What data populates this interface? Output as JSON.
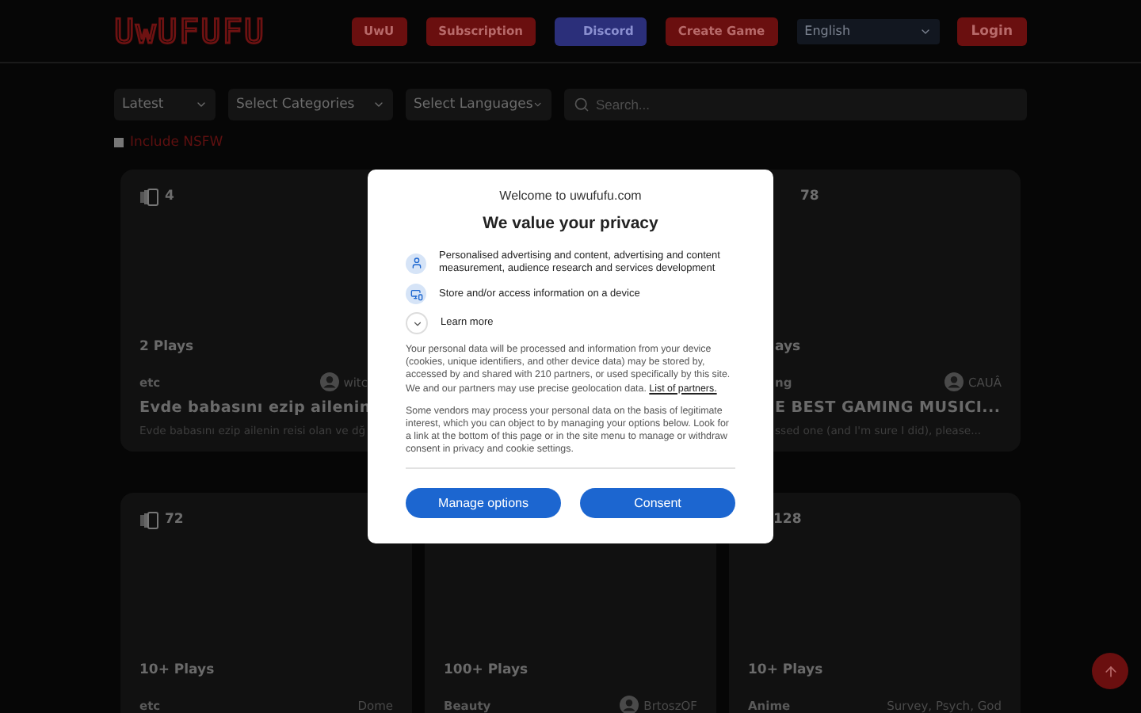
{
  "header": {
    "logo": "UwUFUFU",
    "buttons": [
      {
        "label": "UwU",
        "kind": "red"
      },
      {
        "label": "Subscription",
        "kind": "red"
      },
      {
        "label": "Discord",
        "kind": "blue"
      },
      {
        "label": "Create Game",
        "kind": "red"
      }
    ],
    "language": "English",
    "login": "Login"
  },
  "filters": {
    "sort": "Latest",
    "categories": "Select Categories",
    "languages": "Select Languages",
    "search_placeholder": "Search...",
    "nsfw": {
      "label": "Include NSFW",
      "checked": false
    }
  },
  "cards": [
    {
      "kind": "covered_right",
      "count": "4",
      "count_icon": true,
      "plays": "2 Plays",
      "category": "etc",
      "author": "witc",
      "title": "Evde babasını ezip ailenin",
      "description": "Evde babasını ezip ailenin reisi olan ve dğ"
    },
    {
      "kind": "hidden"
    },
    {
      "kind": "covered_left",
      "count": "78",
      "count_icon": false,
      "plays": "ays",
      "category": "ng",
      "author": "CAUÂ",
      "title": "E BEST GAMING MUSICI...",
      "description": "ssed one (and I'm sure I did), please..."
    },
    {
      "kind": "full",
      "count": "72",
      "count_icon": true,
      "plays": "10+ Plays",
      "category": "etc",
      "author": "Dome",
      "author_icon": false
    },
    {
      "kind": "full",
      "plays": "100+ Plays",
      "category": "Beauty",
      "author": "BrtoszOF",
      "author_icon": true
    },
    {
      "kind": "full",
      "count": "128",
      "count_icon": false,
      "plays": "10+ Plays",
      "category": "Anime",
      "author": "Survey, Psych, God",
      "author_icon": false
    }
  ],
  "consent": {
    "welcome": "Welcome to uwufufu.com",
    "title": "We value your privacy",
    "purposes": [
      {
        "kind": "person",
        "text": "Personalised advertising and content, advertising and content measurement, audience research and services development"
      },
      {
        "kind": "device",
        "text": "Store and/or access information on a device"
      }
    ],
    "learn_more": "Learn more",
    "paragraph_1": "Your personal data will be processed and information from your device (cookies, unique identifiers, and other device data) may be stored by, accessed by and shared with 210 partners, or used specifically by this site. We and our partners may use precise geolocation data.",
    "partners_link": "List of partners.",
    "paragraph_2": "Some vendors may process your personal data on the basis of legitimate interest, which you can object to by managing your options below. Look for a link at the bottom of this page or in the site menu to manage or withdraw consent in privacy and cookie settings.",
    "buttons": [
      "Manage options",
      "Consent"
    ]
  }
}
